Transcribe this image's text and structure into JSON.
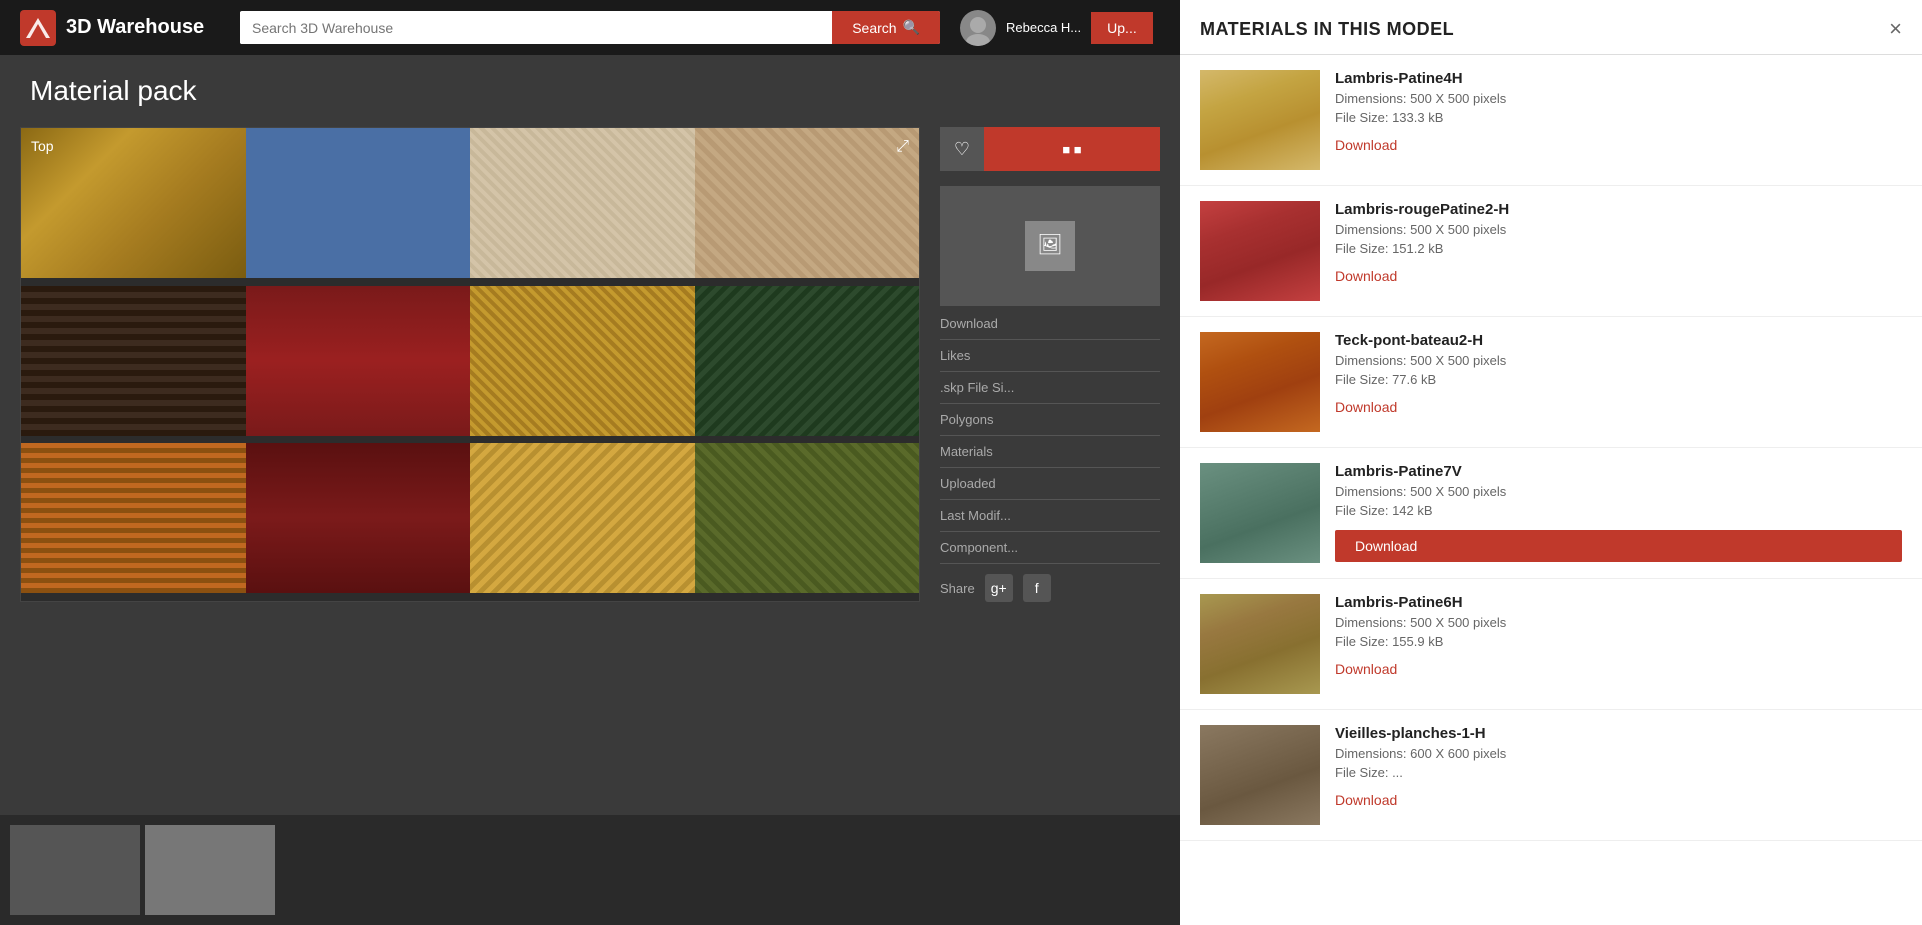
{
  "header": {
    "logo_text": "3D Warehouse",
    "search_placeholder": "Search 3D Warehouse",
    "search_button_label": "Search",
    "upload_button_label": "Up...",
    "user_name": "Rebecca H..."
  },
  "page": {
    "title": "Material pack",
    "viewer_label": "Top"
  },
  "sidebar": {
    "download_label": "Download",
    "likes_label": "Likes",
    "skp_label": ".skp File Si...",
    "polygons_label": "Polygons",
    "materials_label": "Materials",
    "uploaded_label": "Uploaded",
    "last_modified_label": "Last Modif...",
    "components_label": "Component...",
    "share_label": "Share"
  },
  "materials_panel": {
    "title": "MATERIALS IN THIS MODEL",
    "close_label": "×",
    "items": [
      {
        "id": "lambris4h",
        "name": "Lambris-Patine4H",
        "dimensions": "Dimensions: 500 X 500 pixels",
        "file_size": "File Size: 133.3 kB",
        "download_label": "Download",
        "color_class": "mat-lambris4h",
        "active": false
      },
      {
        "id": "lambris-rouge",
        "name": "Lambris-rougePatine2-H",
        "dimensions": "Dimensions: 500 X 500 pixels",
        "file_size": "File Size: 151.2 kB",
        "download_label": "Download",
        "color_class": "mat-lambris-rouge",
        "active": false
      },
      {
        "id": "teck",
        "name": "Teck-pont-bateau2-H",
        "dimensions": "Dimensions: 500 X 500 pixels",
        "file_size": "File Size: 77.6 kB",
        "download_label": "Download",
        "color_class": "mat-teck",
        "active": false
      },
      {
        "id": "lambris7v",
        "name": "Lambris-Patine7V",
        "dimensions": "Dimensions: 500 X 500 pixels",
        "file_size": "File Size: 142 kB",
        "download_label": "Download",
        "color_class": "mat-lambris7v",
        "active": true
      },
      {
        "id": "lambris6h",
        "name": "Lambris-Patine6H",
        "dimensions": "Dimensions: 500 X 500 pixels",
        "file_size": "File Size: 155.9 kB",
        "download_label": "Download",
        "color_class": "mat-lambris6h",
        "active": false
      },
      {
        "id": "vieilles",
        "name": "Vieilles-planches-1-H",
        "dimensions": "Dimensions: 600 X 600 pixels",
        "file_size": "File Size: ...",
        "download_label": "Download",
        "color_class": "mat-vieilles",
        "active": false
      }
    ]
  },
  "swatches": [
    {
      "id": "s1",
      "color_class": "sw-oak"
    },
    {
      "id": "s2",
      "color_class": "sw-blue"
    },
    {
      "id": "s3",
      "color_class": "sw-beige-lines"
    },
    {
      "id": "s4",
      "color_class": "sw-tan"
    },
    {
      "id": "s5",
      "color_class": "sw-dark-wood"
    },
    {
      "id": "s6",
      "color_class": "sw-red"
    },
    {
      "id": "s7",
      "color_class": "sw-parquet"
    },
    {
      "id": "s8",
      "color_class": "sw-dark-green"
    },
    {
      "id": "s9",
      "color_class": "sw-orange-wood"
    },
    {
      "id": "s10",
      "color_class": "sw-dark-red"
    },
    {
      "id": "s11",
      "color_class": "sw-gold"
    },
    {
      "id": "s12",
      "color_class": "sw-olive"
    }
  ]
}
